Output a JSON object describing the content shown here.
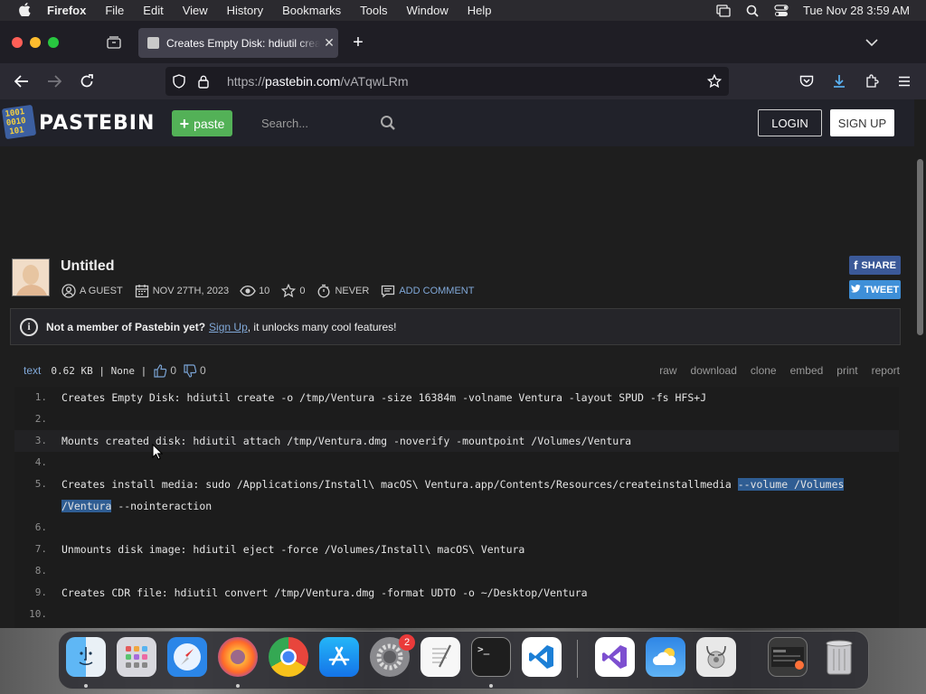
{
  "menubar": {
    "app": "Firefox",
    "items": [
      "File",
      "Edit",
      "View",
      "History",
      "Bookmarks",
      "Tools",
      "Window",
      "Help"
    ],
    "datetime": "Tue Nov 28  3:59 AM"
  },
  "browser": {
    "tab_title": "Creates Empty Disk: hdiutil crea",
    "url_prefix": "https://",
    "url_domain": "pastebin.com",
    "url_path": "/vATqwLRm"
  },
  "pastebin": {
    "logo_text": "PASTEBIN",
    "logo_bits": [
      "1001",
      "0010",
      "101"
    ],
    "paste_button": "paste",
    "search_placeholder": "Search...",
    "login": "LOGIN",
    "signup": "SIGN UP",
    "title": "Untitled",
    "meta": {
      "author": "A GUEST",
      "date": "NOV 27TH, 2023",
      "views": "10",
      "stars": "0",
      "expires": "NEVER",
      "add_comment": "ADD COMMENT"
    },
    "share": "SHARE",
    "tweet": "TWEET",
    "notice": {
      "bold": "Not a member of Pastebin yet?",
      "link": "Sign Up",
      "rest": ", it unlocks many cool features!"
    },
    "codebar": {
      "syntax": "text",
      "info": "0.62 KB | None |",
      "likes": "0",
      "dislikes": "0",
      "actions": [
        "raw",
        "download",
        "clone",
        "embed",
        "print",
        "report"
      ]
    },
    "lines": [
      {
        "n": "1.",
        "text": "Creates Empty Disk: hdiutil create -o /tmp/Ventura -size 16384m -volname Ventura -layout SPUD -fs HFS+J"
      },
      {
        "n": "2.",
        "text": ""
      },
      {
        "n": "3.",
        "text": "Mounts created disk: hdiutil attach /tmp/Ventura.dmg -noverify -mountpoint /Volumes/Ventura"
      },
      {
        "n": "4.",
        "text": ""
      },
      {
        "n": "5.",
        "text_a": "Creates install media: sudo /Applications/Install\\ macOS\\ Ventura.app/Contents/Resources/createinstallmedia ",
        "text_sel1": "--volume /Volumes",
        "text_sel2": "/Ventura",
        "text_b": " --nointeraction"
      },
      {
        "n": "6.",
        "text": ""
      },
      {
        "n": "7.",
        "text": "Unmounts disk image: hdiutil eject -force /Volumes/Install\\ macOS\\ Ventura"
      },
      {
        "n": "8.",
        "text": ""
      },
      {
        "n": "9.",
        "text": "Creates CDR file: hdiutil convert /tmp/Ventura.dmg -format UDTO -o ~/Desktop/Ventura"
      },
      {
        "n": "10.",
        "text": ""
      }
    ]
  },
  "dock": {
    "badge": "2",
    "apps": [
      "finder-icon",
      "launchpad-icon",
      "safari-icon",
      "firefox-icon",
      "chrome-icon",
      "app-store-icon",
      "system-settings-icon",
      "textedit-icon",
      "terminal-icon",
      "vscode-icon",
      "visual-studio-icon",
      "weather-icon",
      "disk-utility-icon",
      "screenshot-icon",
      "trash-icon"
    ]
  }
}
